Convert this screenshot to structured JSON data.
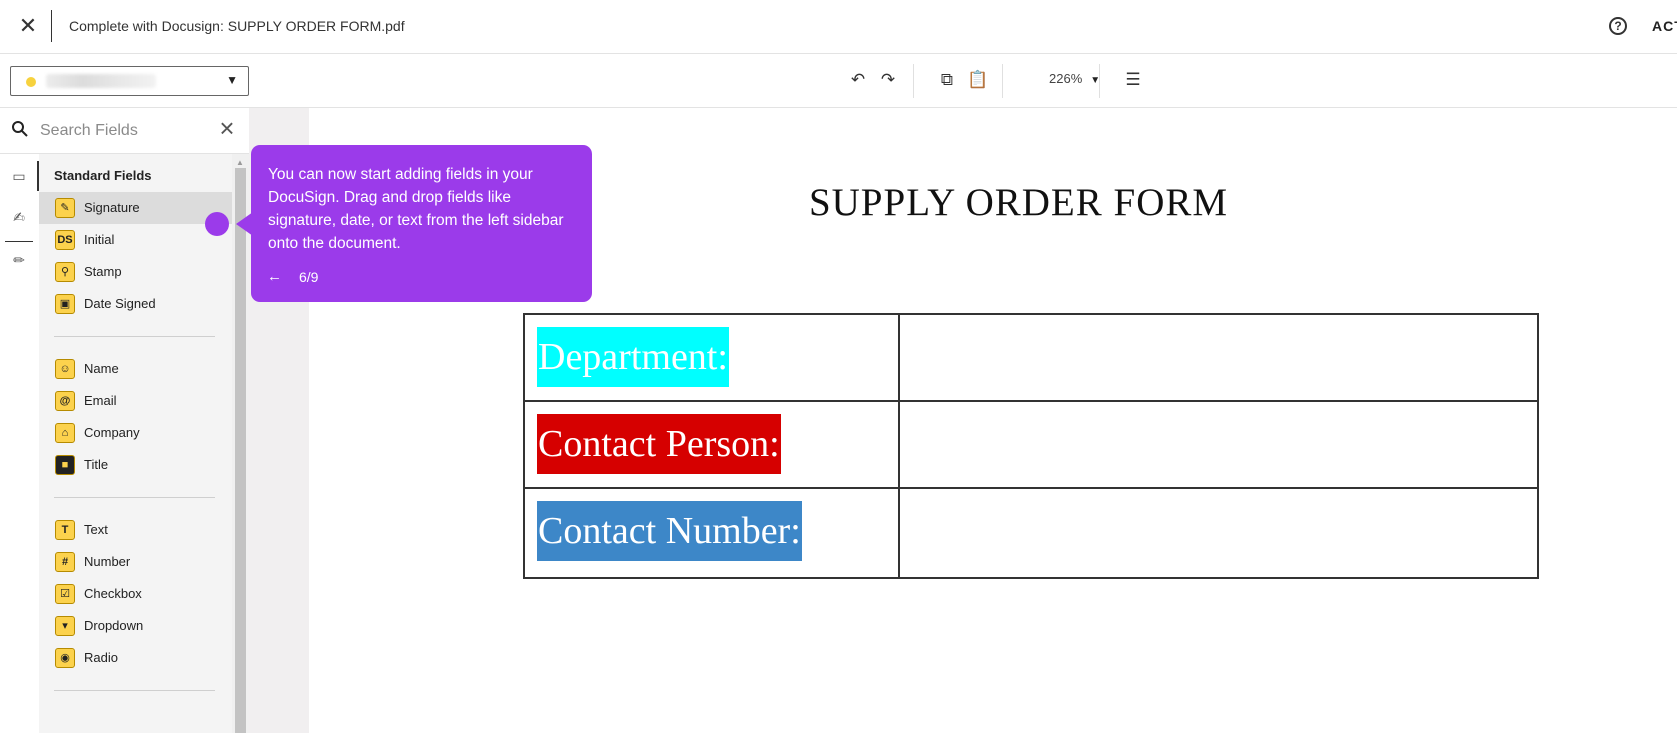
{
  "header": {
    "title": "Complete with Docusign: SUPPLY ORDER FORM.pdf",
    "close_icon": "close-icon",
    "help_icon": "help-circle-icon",
    "help_glyph": "?",
    "actions_label": "ACT"
  },
  "toolbar": {
    "recipient_color": "#f7d23e",
    "undo_icon": "undo-icon",
    "redo_icon": "redo-icon",
    "copy_icon": "copy-icon",
    "paste_icon": "paste-icon",
    "zoom": "226%",
    "comment_icon": "comment-add-icon"
  },
  "search": {
    "placeholder": "Search Fields",
    "search_icon": "search-icon",
    "clear_icon": "close-icon"
  },
  "panel": {
    "heading": "Standard Fields",
    "groups": [
      [
        {
          "label": "Signature",
          "icon": "pen-icon",
          "glyph": "✎",
          "active": true
        },
        {
          "label": "Initial",
          "icon": "initials-icon",
          "glyph": "DS"
        },
        {
          "label": "Stamp",
          "icon": "stamp-icon",
          "glyph": "⚲"
        },
        {
          "label": "Date Signed",
          "icon": "calendar-icon",
          "glyph": "▣"
        }
      ],
      [
        {
          "label": "Name",
          "icon": "person-icon",
          "glyph": "☺"
        },
        {
          "label": "Email",
          "icon": "at-icon",
          "glyph": "@"
        },
        {
          "label": "Company",
          "icon": "building-icon",
          "glyph": "⌂"
        },
        {
          "label": "Title",
          "icon": "briefcase-icon",
          "glyph": "■"
        }
      ],
      [
        {
          "label": "Text",
          "icon": "text-icon",
          "glyph": "T"
        },
        {
          "label": "Number",
          "icon": "hash-icon",
          "glyph": "#"
        },
        {
          "label": "Checkbox",
          "icon": "checkbox-icon",
          "glyph": "☑"
        },
        {
          "label": "Dropdown",
          "icon": "dropdown-icon",
          "glyph": "▾"
        },
        {
          "label": "Radio",
          "icon": "radio-icon",
          "glyph": "◉"
        }
      ]
    ]
  },
  "document": {
    "title": "SUPPLY ORDER FORM",
    "rows": [
      {
        "label": "Department:",
        "bg": "#00ffff",
        "color": "#ffffff"
      },
      {
        "label": "Contact Person:",
        "bg": "#d60000",
        "color": "#ffffff"
      },
      {
        "label": "Contact Number:",
        "bg": "#3d87c8",
        "color": "#ffffff"
      }
    ]
  },
  "tooltip": {
    "text": "You can now start adding fields in your DocuSign. Drag and drop fields like signature, date, or text from the left sidebar onto the document.",
    "prev_glyph": "←",
    "counter": "6/9",
    "color": "#9b3bea"
  }
}
